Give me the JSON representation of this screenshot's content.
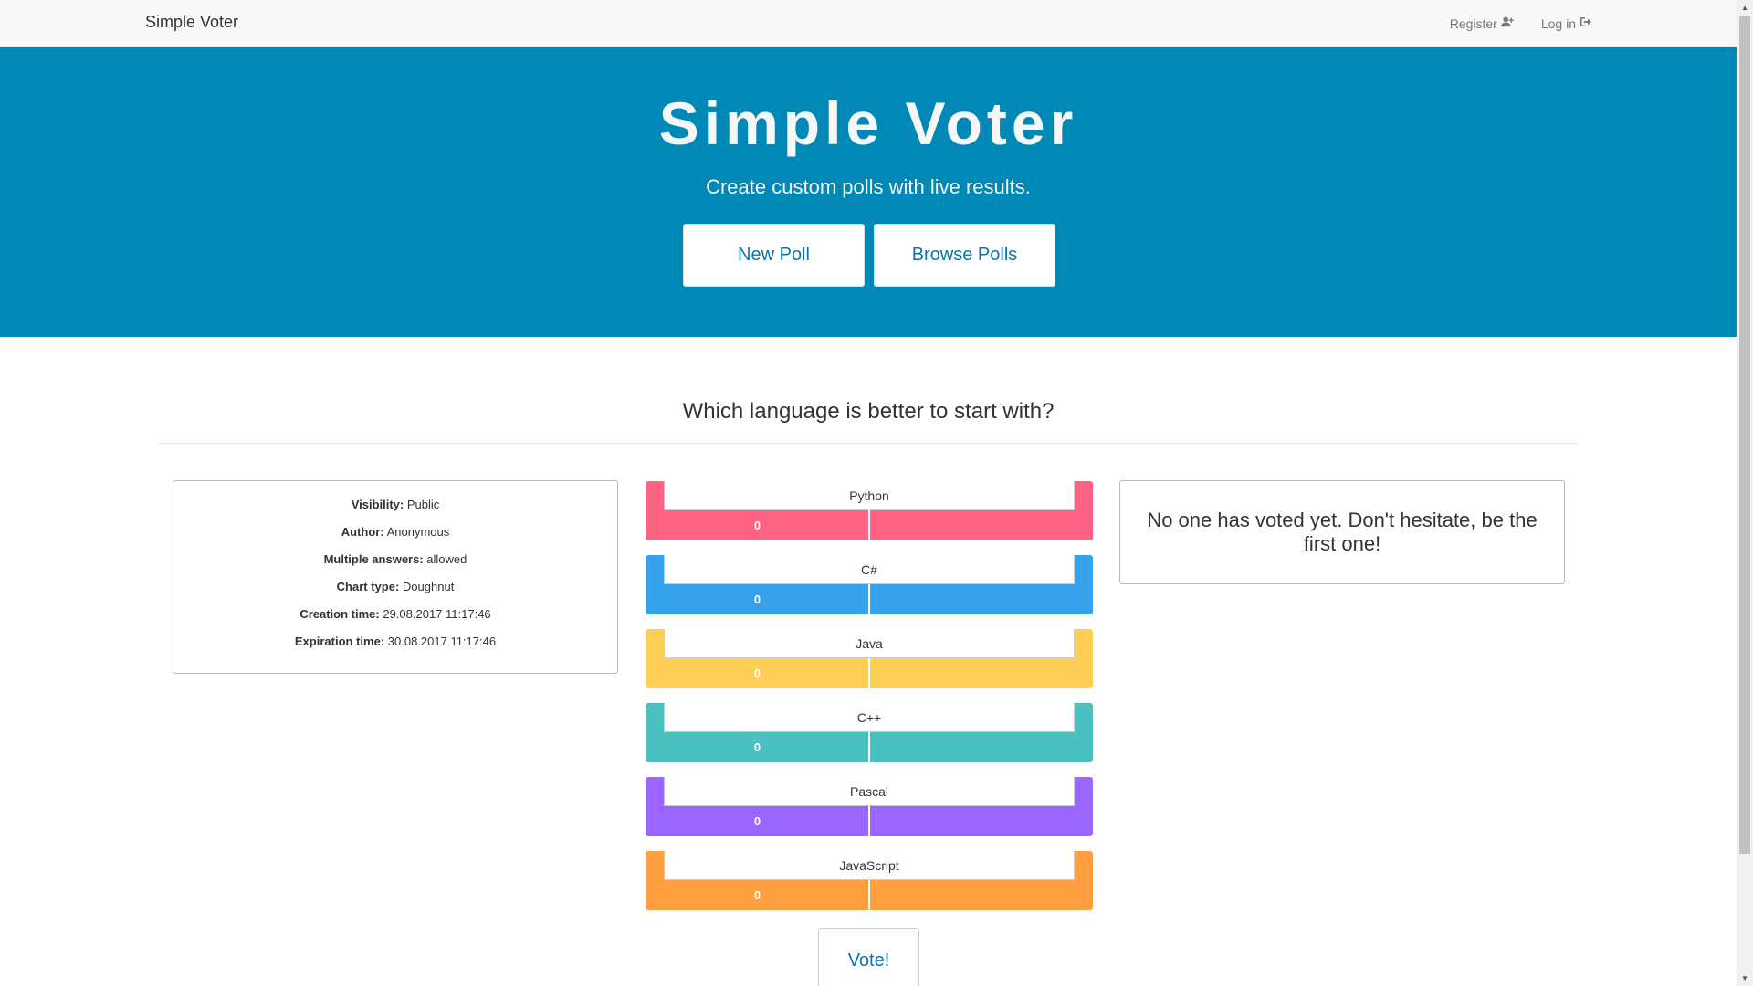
{
  "navbar": {
    "brand": "Simple Voter",
    "register": "Register",
    "login": "Log in"
  },
  "hero": {
    "title": "Simple Voter",
    "subtitle": "Create custom polls with live results.",
    "new_poll": "New Poll",
    "browse_polls": "Browse Polls"
  },
  "poll": {
    "question": "Which language is better to start with?",
    "info": [
      {
        "label": "Visibility:",
        "value": "Public"
      },
      {
        "label": "Author:",
        "value": "Anonymous"
      },
      {
        "label": "Multiple answers:",
        "value": "allowed"
      },
      {
        "label": "Chart type:",
        "value": "Doughnut"
      },
      {
        "label": "Creation time:",
        "value": "29.08.2017 11:17:46"
      },
      {
        "label": "Expiration time:",
        "value": "30.08.2017 11:17:46"
      }
    ],
    "options": [
      {
        "label": "Python",
        "count": "0",
        "color": "#ff6384"
      },
      {
        "label": "C#",
        "count": "0",
        "color": "#36a2eb"
      },
      {
        "label": "Java",
        "count": "0",
        "color": "#ffce56"
      },
      {
        "label": "C++",
        "count": "0",
        "color": "#4bc0c0"
      },
      {
        "label": "Pascal",
        "count": "0",
        "color": "#9966ff"
      },
      {
        "label": "JavaScript",
        "count": "0",
        "color": "#ff9f40"
      }
    ],
    "no_votes_message": "No one has voted yet. Don't hesitate, be the first one!",
    "vote_button": "Vote!"
  },
  "icons": {
    "register": "user-plus-icon",
    "login": "sign-in-icon"
  },
  "colors": {
    "hero_bg": "#0088b6",
    "link": "#0b75a8"
  }
}
